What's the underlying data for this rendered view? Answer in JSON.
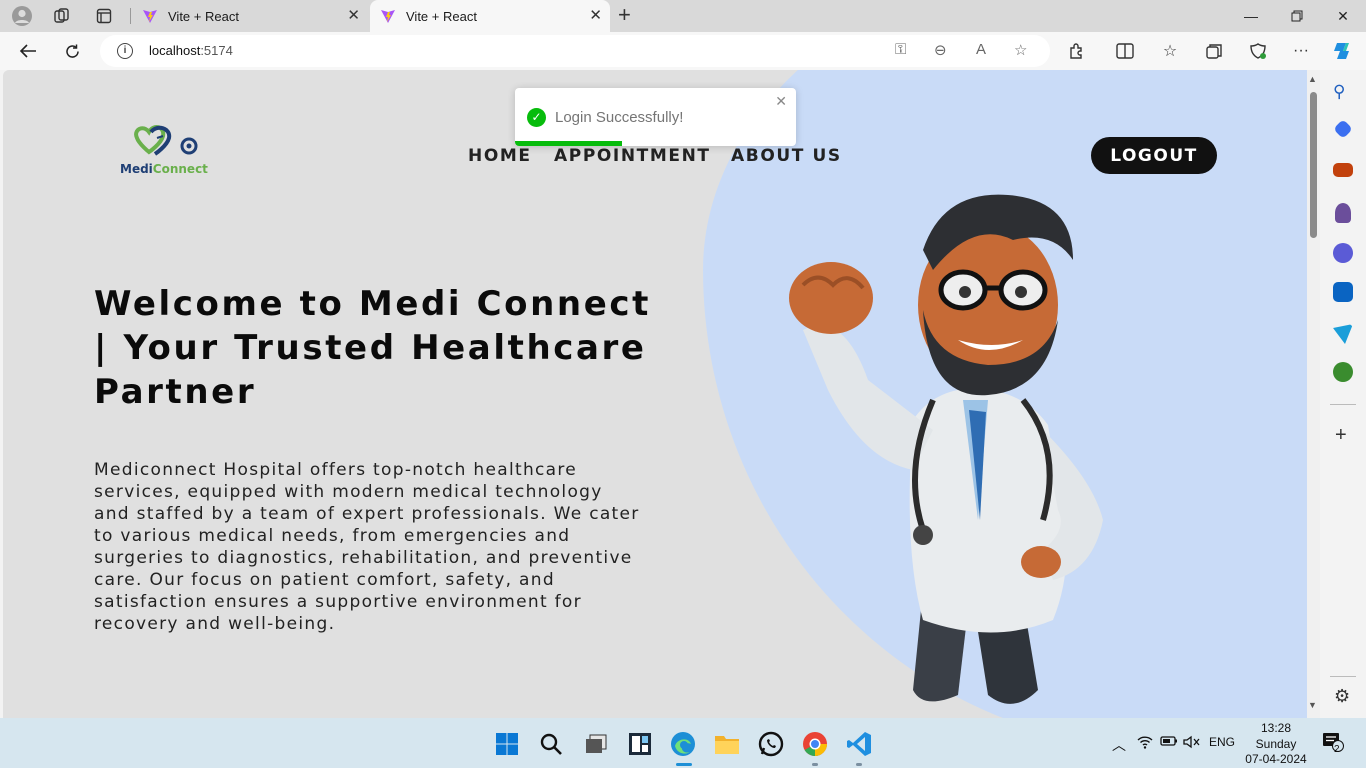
{
  "browser": {
    "tabs": [
      {
        "title": "Vite + React",
        "active": false
      },
      {
        "title": "Vite + React",
        "active": true
      }
    ],
    "address": {
      "host": "localhost",
      "port": ":5174"
    }
  },
  "page": {
    "logo": {
      "part1": "Medi",
      "part2": "Connect"
    },
    "nav": {
      "home": "HOME",
      "appointment": "APPOINTMENT",
      "about": "ABOUT US"
    },
    "logout_label": "LOGOUT",
    "hero": {
      "title": "Welcome to Medi Connect | Your Trusted Healthcare Partner",
      "description": "Mediconnect Hospital offers top-notch healthcare services, equipped with modern medical technology and staffed by a team of expert professionals. We cater to various medical needs, from emergencies and surgeries to diagnostics, rehabilitation, and preventive care. Our focus on patient comfort, safety, and satisfaction ensures a supportive environment for recovery and well-being."
    },
    "toast": {
      "message": "Login Successfully!",
      "progress_fraction": 0.38
    }
  },
  "taskbar": {
    "language": "ENG",
    "time": "13:28",
    "day": "Sunday",
    "date": "07-04-2024",
    "notification_count": "2"
  },
  "colors": {
    "accent_blue": "#c9dbf7",
    "toast_green": "#07bc0c",
    "logo_navy": "#1f3f75",
    "logo_green": "#6ab04c"
  }
}
